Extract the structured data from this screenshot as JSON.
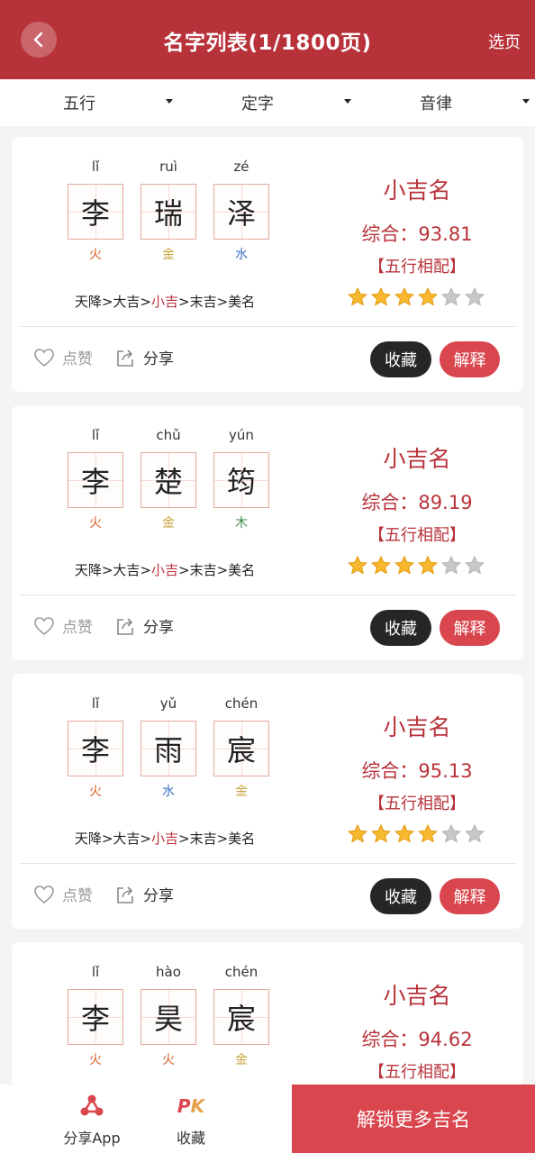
{
  "header": {
    "title": "名字列表(1/1800页)",
    "select_page": "选页"
  },
  "filters": [
    {
      "label": "五行"
    },
    {
      "label": "定字"
    },
    {
      "label": "音律"
    }
  ],
  "cards": [
    {
      "chars": [
        {
          "pinyin": "lǐ",
          "char": "李",
          "element": "火",
          "element_color": "#d9622b"
        },
        {
          "pinyin": "ruì",
          "char": "瑞",
          "element": "金",
          "element_color": "#c8a23a"
        },
        {
          "pinyin": "zé",
          "char": "泽",
          "element": "水",
          "element_color": "#3d6fc2"
        }
      ],
      "path": {
        "pre": "天降>大吉>",
        "highlight": "小吉",
        "post": ">末吉>美名"
      },
      "rating_title": "小吉名",
      "score": "综合：93.81",
      "wuxing": "【五行相配】",
      "stars_filled": 4,
      "stars_total": 6,
      "like": "点赞",
      "share": "分享",
      "collect": "收藏",
      "explain": "解释"
    },
    {
      "chars": [
        {
          "pinyin": "lǐ",
          "char": "李",
          "element": "火",
          "element_color": "#d9622b"
        },
        {
          "pinyin": "chǔ",
          "char": "楚",
          "element": "金",
          "element_color": "#c8a23a"
        },
        {
          "pinyin": "yún",
          "char": "筠",
          "element": "木",
          "element_color": "#3c8a4a"
        }
      ],
      "path": {
        "pre": "天降>大吉>",
        "highlight": "小吉",
        "post": ">末吉>美名"
      },
      "rating_title": "小吉名",
      "score": "综合：89.19",
      "wuxing": "【五行相配】",
      "stars_filled": 4,
      "stars_total": 6,
      "like": "点赞",
      "share": "分享",
      "collect": "收藏",
      "explain": "解释"
    },
    {
      "chars": [
        {
          "pinyin": "lǐ",
          "char": "李",
          "element": "火",
          "element_color": "#d9622b"
        },
        {
          "pinyin": "yǔ",
          "char": "雨",
          "element": "水",
          "element_color": "#3d6fc2"
        },
        {
          "pinyin": "chén",
          "char": "宸",
          "element": "金",
          "element_color": "#c8a23a"
        }
      ],
      "path": {
        "pre": "天降>大吉>",
        "highlight": "小吉",
        "post": ">末吉>美名"
      },
      "rating_title": "小吉名",
      "score": "综合：95.13",
      "wuxing": "【五行相配】",
      "stars_filled": 4,
      "stars_total": 6,
      "like": "点赞",
      "share": "分享",
      "collect": "收藏",
      "explain": "解释"
    },
    {
      "chars": [
        {
          "pinyin": "lǐ",
          "char": "李",
          "element": "火",
          "element_color": "#d9622b"
        },
        {
          "pinyin": "hào",
          "char": "昊",
          "element": "火",
          "element_color": "#d9622b"
        },
        {
          "pinyin": "chén",
          "char": "宸",
          "element": "金",
          "element_color": "#c8a23a"
        }
      ],
      "rating_title": "小吉名",
      "score": "综合：94.62",
      "wuxing": "【五行相配】"
    }
  ],
  "bottom_bar": {
    "share_app": "分享App",
    "favorites": "收藏",
    "unlock": "解锁更多吉名"
  },
  "colors": {
    "brand": "#b8323a",
    "accent": "#d9464e",
    "dark_button": "#262626",
    "star_filled": "#f5b82e",
    "star_empty": "#c8c8c8"
  }
}
